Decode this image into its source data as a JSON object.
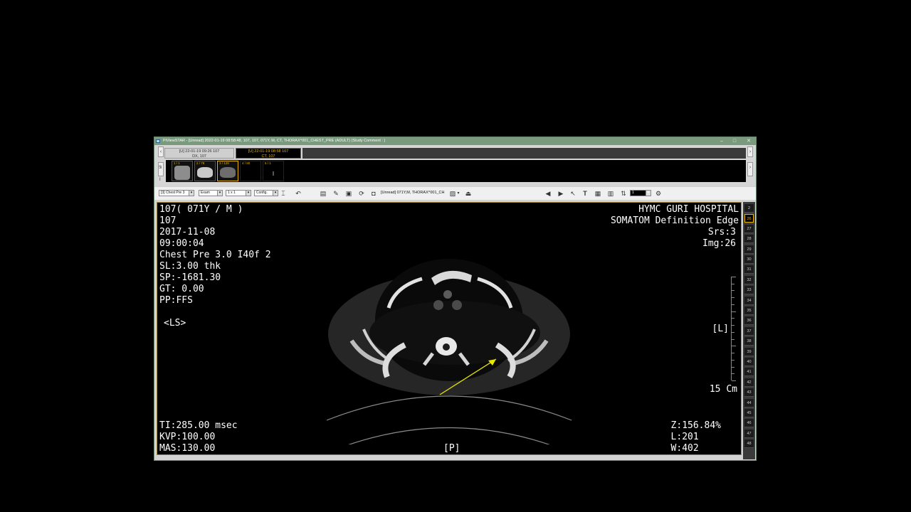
{
  "window": {
    "title": "PiViewSTAR - [Unread] 2022-01-19 08:58:48, 107, 107, 071Y, M, CT, THORAX^001_CHEST_PRE (ADULT)  (Study Comment : )"
  },
  "tabs": [
    {
      "line1": "[U] 22-01-19 09:26  107",
      "line2": "DX, 107"
    },
    {
      "line1": "[U] 22-01-19 08:58  107",
      "line2": "CT, 107"
    }
  ],
  "thumb_side": {
    "top": "S",
    "bottom": "I"
  },
  "thumbnails": [
    {
      "label": "1 / 1"
    },
    {
      "label": "2 / 78"
    },
    {
      "label": "3 / 129"
    },
    {
      "label": "4 / 80"
    },
    {
      "label": "5 / 1"
    }
  ],
  "toolbar": {
    "series_select": "[3] Chest Pre 3",
    "exam_select": "Exam",
    "layout_select": "1 x 1",
    "config_select": "Config.",
    "study_label": "[Unread] 071Y,M, THORAX^001_CH",
    "frame_select": "1"
  },
  "overlay": {
    "top_left": [
      "107( 071Y / M )",
      "107",
      "2017-11-08",
      "09:00:04",
      "Chest Pre  3.0  I40f  2",
      "SL:3.00 thk",
      "SP:-1681.30",
      "GT: 0.00",
      "PP:FFS"
    ],
    "ls_marker": "<LS>",
    "top_right": [
      "HYMC GURI HOSPITAL",
      "SOMATOM Definition Edge",
      "Srs:3",
      "Img:26"
    ],
    "left_marker": "[L]",
    "scale_label": "15 Cm",
    "bottom_left": [
      "TI:285.00 msec",
      "KVP:100.00",
      "MAS:130.00"
    ],
    "bottom_center": "[P]",
    "bottom_right": [
      "Z:156.84%",
      "L:201",
      "W:402"
    ]
  },
  "slices": [
    "2",
    "26",
    "27",
    "28",
    "29",
    "30",
    "31",
    "32",
    "33",
    "34",
    "35",
    "36",
    "37",
    "38",
    "39",
    "40",
    "41",
    "42",
    "43",
    "44",
    "45",
    "46",
    "47",
    "48"
  ],
  "selected_slice": "26",
  "colors": {
    "accent": "#e6b400",
    "titlebar": "#7a9a7d",
    "viewer_border": "#a08b2f"
  }
}
